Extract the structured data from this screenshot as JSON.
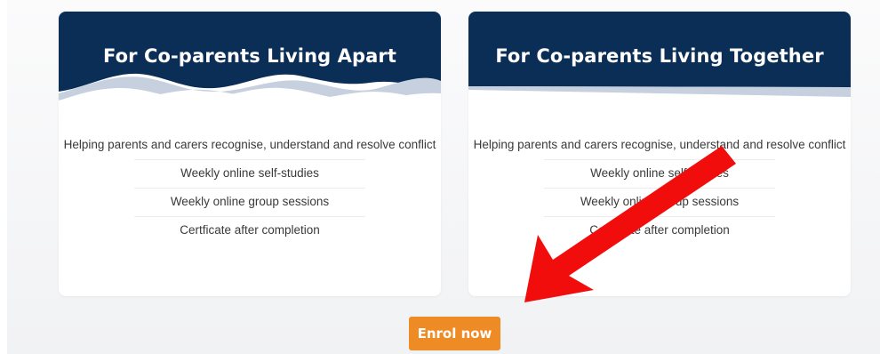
{
  "colors": {
    "header_navy": "#0b2e57",
    "wave_light": "#c6d0de",
    "button_orange": "#ef8b25",
    "arrow_red": "#f20d0d"
  },
  "cards": [
    {
      "title": "For Co-parents Living Apart",
      "features": [
        "Helping parents and carers recognise, understand and resolve conflict",
        "Weekly online self-studies",
        "Weekly online group sessions",
        "Certficate after completion"
      ]
    },
    {
      "title": "For Co-parents Living Together",
      "features": [
        "Helping parents and carers recognise, understand and resolve conflict",
        "Weekly online self-studies",
        "Weekly online group sessions",
        "Certficate after completion"
      ]
    }
  ],
  "enrol": {
    "label": "Enrol now"
  },
  "annotation": {
    "icon": "red-arrow-icon"
  }
}
